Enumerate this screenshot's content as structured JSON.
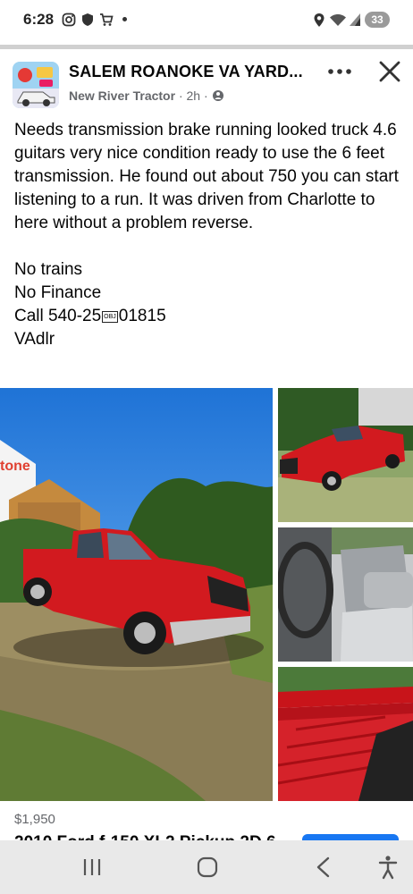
{
  "status_bar": {
    "time": "6:28",
    "battery": "33",
    "icons": [
      "instagram-icon",
      "shield-icon",
      "cart-icon",
      "location-icon",
      "wifi-icon",
      "signal-icon"
    ]
  },
  "post": {
    "group_name": "SALEM ROANOKE VA YARD...",
    "author": "New River Tractor",
    "time_ago": "2h",
    "audience_icon": "globe-icon",
    "body": [
      "Needs transmission brake running looked truck 4.6 guitars very nice condition ready to use the 6 feet transmission. He found out about 750 you can start listening to a run. It was driven from Charlotte to here without a problem reverse."
    ],
    "lines": [
      "No trains",
      "No Finance"
    ],
    "call_prefix": "Call 540-25",
    "obj_marker": "OBJ",
    "call_suffix": "01815",
    "sign_off": "VAdlr"
  },
  "gallery": {
    "photos": [
      "red-pickup-truck-front-view",
      "red-pickup-truck-side-view",
      "truck-interior-seats",
      "truck-bed-view"
    ]
  },
  "listing": {
    "price": "$1,950",
    "title": "2010 Ford f-150 XL2 Pickup 2D 6"
  },
  "colors": {
    "accent": "#1877f2",
    "truck_red": "#d21a1f",
    "text_secondary": "#65676b"
  },
  "nav_bar": {
    "icons": [
      "recent-apps-icon",
      "home-icon",
      "back-icon",
      "accessibility-icon"
    ]
  }
}
